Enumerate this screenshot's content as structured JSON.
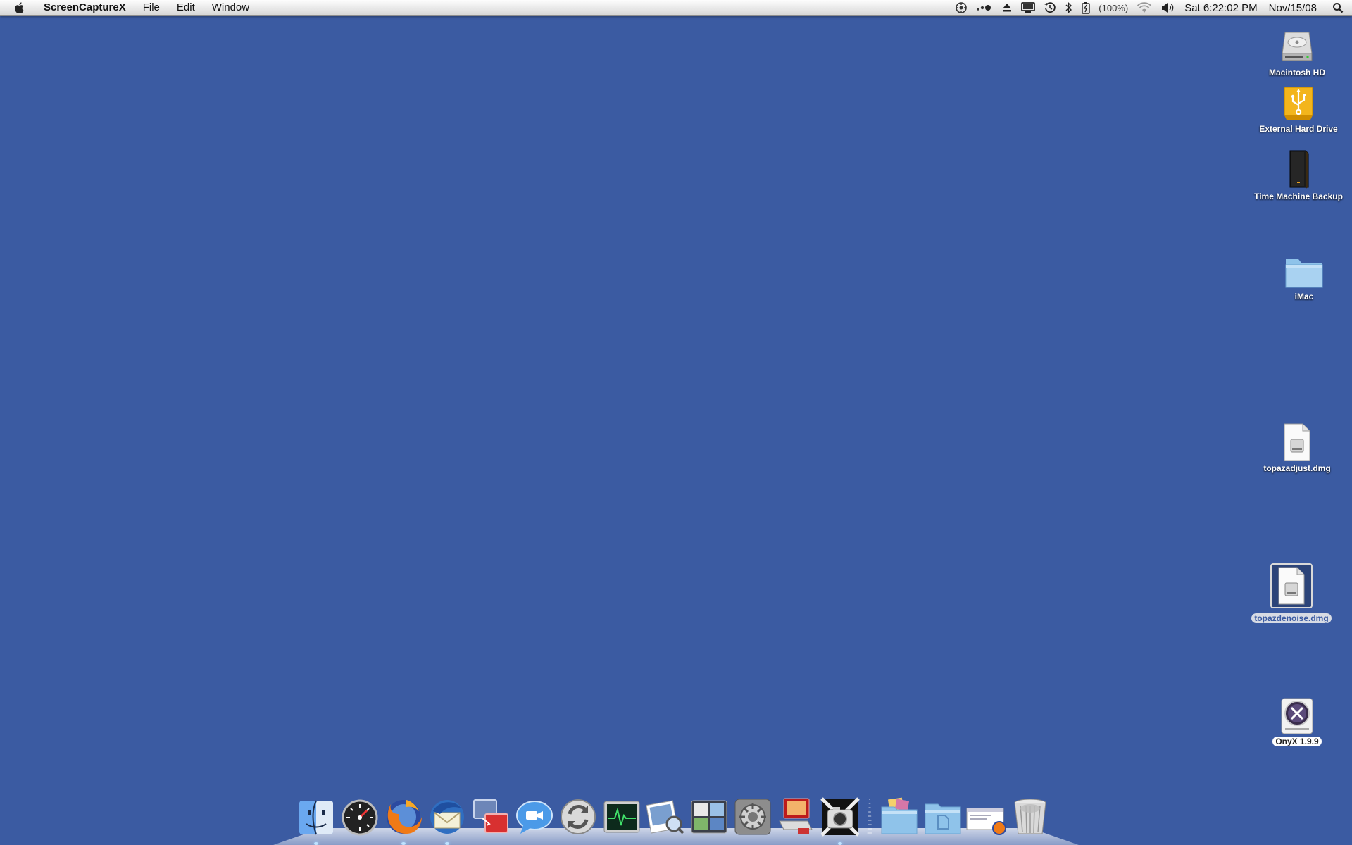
{
  "menubar": {
    "app_name": "ScreenCaptureX",
    "items": [
      "File",
      "Edit",
      "Window"
    ],
    "battery_text": "(100%)",
    "clock": "Sat 6:22:02 PM",
    "date": "Nov/15/08"
  },
  "desktop": {
    "background_color": "#3b5ba2",
    "icons": [
      {
        "label": "Macintosh HD",
        "icon": "hard-drive-icon"
      },
      {
        "label": "External Hard Drive",
        "icon": "usb-drive-icon"
      },
      {
        "label": "Time Machine Backup",
        "icon": "backup-drive-icon"
      },
      {
        "label": "iMac",
        "icon": "folder-icon"
      },
      {
        "label": "topazadjust.dmg",
        "icon": "disk-image-icon"
      },
      {
        "label": "topazdenoise.dmg",
        "icon": "disk-image-icon",
        "selected": true
      },
      {
        "label": "OnyX 1.9.9",
        "icon": "mounted-volume-icon"
      }
    ]
  },
  "dock": {
    "items": [
      {
        "name": "Finder",
        "icon": "finder-icon",
        "running": true
      },
      {
        "name": "Dashboard",
        "icon": "dashboard-icon",
        "running": false
      },
      {
        "name": "Firefox",
        "icon": "firefox-icon",
        "running": true
      },
      {
        "name": "Thunderbird",
        "icon": "thunderbird-icon",
        "running": true
      },
      {
        "name": "Screen Sharing",
        "icon": "screen-sharing-icon",
        "running": false
      },
      {
        "name": "iChat",
        "icon": "ichat-icon",
        "running": false
      },
      {
        "name": "Sync",
        "icon": "sync-icon",
        "running": false
      },
      {
        "name": "Activity Monitor",
        "icon": "activity-monitor-icon",
        "running": false
      },
      {
        "name": "Preview",
        "icon": "preview-icon",
        "running": false
      },
      {
        "name": "Spaces",
        "icon": "spaces-icon",
        "running": false
      },
      {
        "name": "System Preferences",
        "icon": "system-preferences-icon",
        "running": false
      },
      {
        "name": "Photo Booth",
        "icon": "photo-booth-icon",
        "running": false
      },
      {
        "name": "ScreenCaptureX",
        "icon": "camera-icon",
        "running": true
      }
    ],
    "stacks": [
      {
        "name": "Applications",
        "icon": "stack-folder-icon"
      },
      {
        "name": "Documents",
        "icon": "documents-folder-icon"
      },
      {
        "name": "Downloads",
        "icon": "downloads-stack-icon"
      },
      {
        "name": "Trash",
        "icon": "trash-icon"
      }
    ]
  }
}
